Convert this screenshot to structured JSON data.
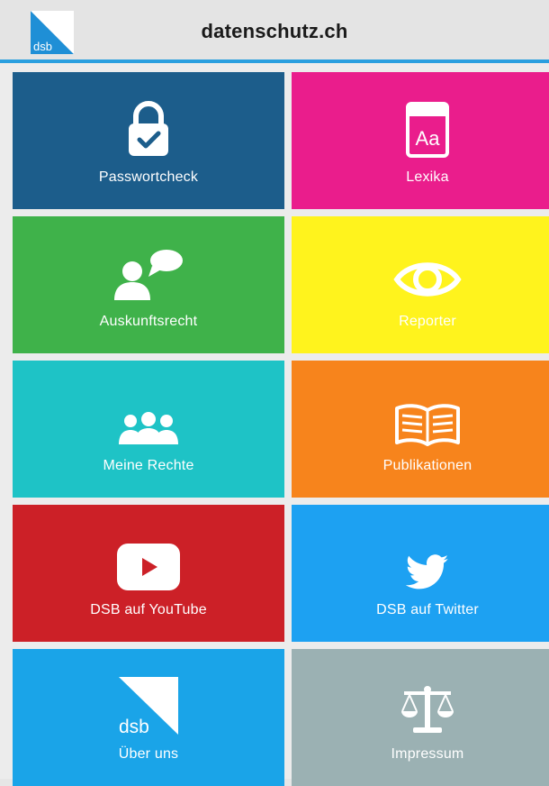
{
  "header": {
    "title": "datenschutz.ch",
    "logo_text": "dsb",
    "accent_color": "#2a9fdf"
  },
  "tiles": [
    {
      "id": "passwortcheck",
      "label": "Passwortcheck",
      "color": "#1c5d8b",
      "icon": "padlock-check-icon"
    },
    {
      "id": "lexika",
      "label": "Lexika",
      "color": "#ea1d8c",
      "icon": "dictionary-book-icon",
      "icon_text": "Aa"
    },
    {
      "id": "auskunftsrecht",
      "label": "Auskunftsrecht",
      "color": "#3fb24a",
      "icon": "person-speech-icon"
    },
    {
      "id": "reporter",
      "label": "Reporter",
      "color": "#fff31d",
      "icon": "eye-icon"
    },
    {
      "id": "meine-rechte",
      "label": "Meine Rechte",
      "color": "#1ec3c6",
      "icon": "people-group-icon"
    },
    {
      "id": "publikationen",
      "label": "Publikationen",
      "color": "#f7841c",
      "icon": "open-book-icon"
    },
    {
      "id": "youtube",
      "label": "DSB auf YouTube",
      "color": "#cc2027",
      "icon": "youtube-play-icon"
    },
    {
      "id": "twitter",
      "label": "DSB auf Twitter",
      "color": "#1da1f2",
      "icon": "twitter-bird-icon"
    },
    {
      "id": "ueber-uns",
      "label": "Über uns",
      "color": "#1aa4e8",
      "icon": "dsb-logo-icon",
      "icon_text": "dsb"
    },
    {
      "id": "impressum",
      "label": "Impressum",
      "color": "#9bb1b3",
      "icon": "scales-icon"
    }
  ]
}
